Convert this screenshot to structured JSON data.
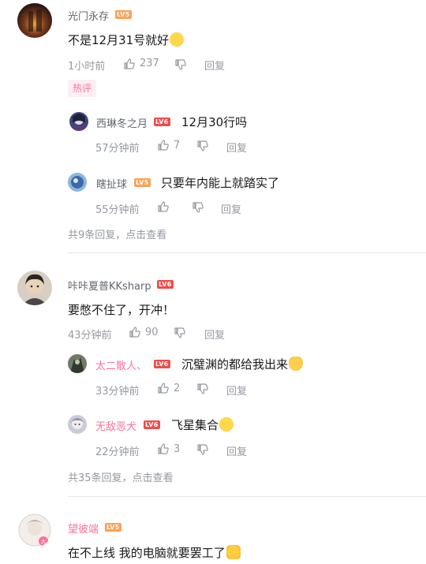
{
  "comments": [
    {
      "user": "光门永存",
      "level": "LV5",
      "text": "不是12月31号就好",
      "time": "1小时前",
      "likes": "237",
      "reply_label": "回复",
      "hot_tag": "热评",
      "replies": [
        {
          "user": "西琳冬之月",
          "level": "LV6",
          "text": "12月30行吗",
          "time": "57分钟前",
          "likes": "7",
          "reply_label": "回复"
        },
        {
          "user": "瞎扯球",
          "level": "LV5",
          "text": "只要年内能上就踏实了",
          "time": "55分钟前",
          "likes": "",
          "reply_label": "回复"
        }
      ],
      "view_more": "共9条回复，点击查看"
    },
    {
      "user": "咔咔夏普KKsharp",
      "level": "LV6",
      "text": "要憋不住了，开冲！",
      "time": "43分钟前",
      "likes": "90",
      "reply_label": "回复",
      "replies": [
        {
          "user": "太二散人、",
          "level": "LV6",
          "text": "沉璧渊的都给我出来",
          "time": "33分钟前",
          "likes": "2",
          "reply_label": "回复"
        },
        {
          "user": "无敌恶犬",
          "level": "LV6",
          "text": "飞星集合",
          "time": "22分钟前",
          "likes": "3",
          "reply_label": "回复"
        }
      ],
      "view_more": "共35条回复，点击查看"
    },
    {
      "user": "望彼端",
      "level": "LV5",
      "text": "在不上线 我的电脑就要罢工了"
    }
  ],
  "colors": {
    "username_pink": "#fb7299",
    "lv5": "#ff9f52",
    "lv6": "#f04c49",
    "meta_gray": "#9499a0"
  }
}
